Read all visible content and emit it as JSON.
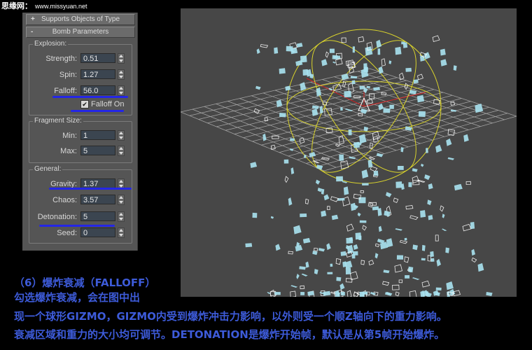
{
  "watermark": {
    "site_name": "思缘网：",
    "url": "www.missyuan.net"
  },
  "rollouts": {
    "supports_objects": {
      "sign": "+",
      "label": "Supports Objects of Type"
    },
    "bomb_parameters": {
      "sign": "-",
      "label": "Bomb Parameters"
    }
  },
  "explosion": {
    "title": "Explosion:",
    "strength": {
      "label": "Strength:",
      "value": "0.51"
    },
    "spin": {
      "label": "Spin:",
      "value": "1.27"
    },
    "falloff": {
      "label": "Falloff:",
      "value": "56.0"
    },
    "falloff_on": {
      "label": "Falloff On",
      "checked": true,
      "mark": "✔"
    }
  },
  "fragment_size": {
    "title": "Fragment Size:",
    "min": {
      "label": "Min:",
      "value": "1"
    },
    "max": {
      "label": "Max:",
      "value": "5"
    }
  },
  "general": {
    "title": "General:",
    "gravity": {
      "label": "Gravity:",
      "value": "1.37"
    },
    "chaos": {
      "label": "Chaos:",
      "value": "3.57"
    },
    "detonation": {
      "label": "Detonation:",
      "value": "5"
    },
    "seed": {
      "label": "Seed:",
      "value": "0"
    }
  },
  "caption": {
    "line1": "（6）爆炸衰减（FALLOFF）",
    "line2": "勾选爆炸衰减，会在图中出",
    "line3": "现一个球形GIZMO，GIZMO内受到爆炸冲击力影响，以外则受一个顺Z轴向下的重力影响。",
    "line4": "衰减区域和重力的大小均可调节。DETONATION是爆炸开始帧，默认是从第5帧开始爆炸。"
  },
  "colors": {
    "panel_bg": "#555555",
    "viewport_bg": "#474747",
    "grid": "#a6a6a6",
    "gizmo": "#d8d22c",
    "fragments": "#a8e2ef",
    "highlight_underline": "#2426e6",
    "caption_text": "#3d5bd9"
  }
}
